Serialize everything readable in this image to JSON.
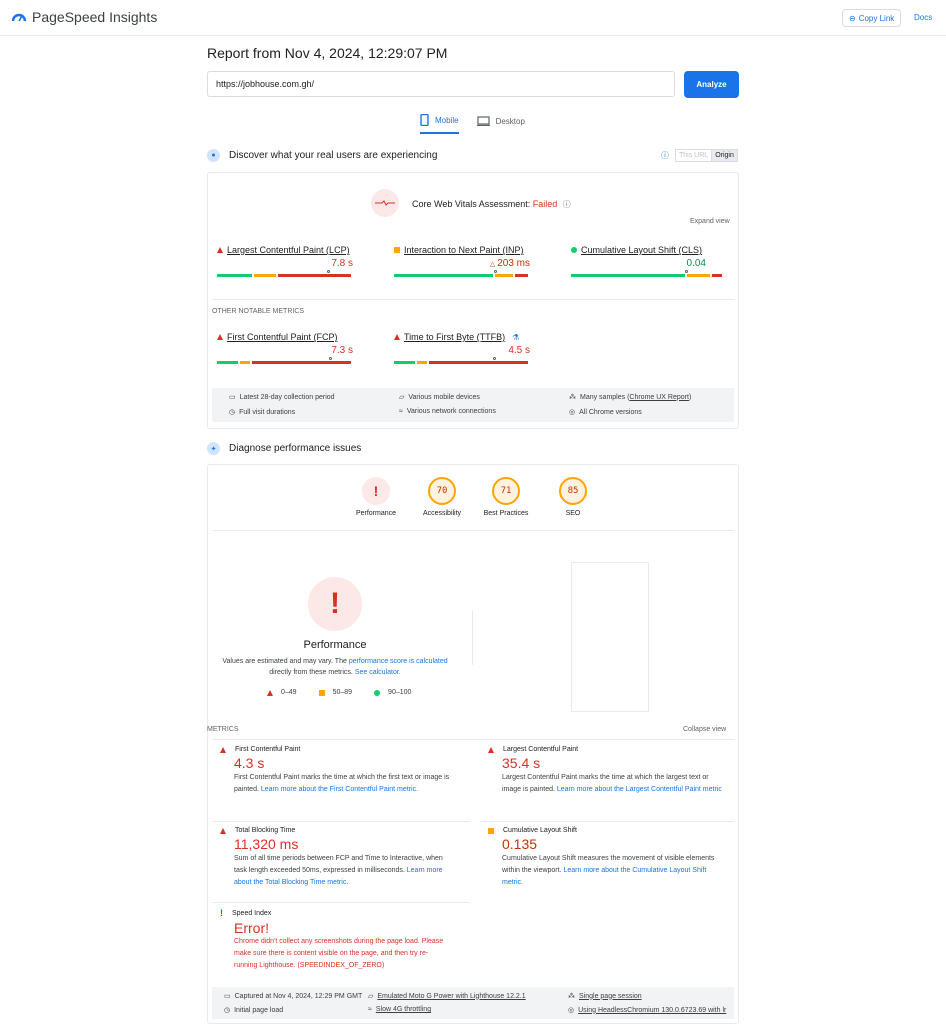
{
  "app": {
    "title": "PageSpeed Insights",
    "copy_link": "Copy Link",
    "docs": "Docs"
  },
  "report": {
    "title": "Report from Nov 4, 2024, 12:29:07 PM",
    "url": "https://jobhouse.com.gh/",
    "analyze": "Analyze",
    "tabs": [
      "Mobile",
      "Desktop"
    ]
  },
  "field": {
    "heading": "Discover what your real users are experiencing",
    "toggle": [
      "This URL",
      "Origin"
    ],
    "assessment_label": "Core Web Vitals Assessment:",
    "assessment_status": "Failed",
    "expand": "Expand view",
    "other_label": "OTHER NOTABLE METRICS",
    "metrics": [
      {
        "name": "Largest Contentful Paint (LCP)",
        "value": "7.8 s",
        "status": "fail",
        "distribution": [
          0.27,
          0.18,
          0.55
        ],
        "marker": 0.82
      },
      {
        "name": "Interaction to Next Paint (INP)",
        "value": "203 ms",
        "status": "average",
        "distribution": [
          0.74,
          0.15,
          0.11
        ],
        "marker": 0.75
      },
      {
        "name": "Cumulative Layout Shift (CLS)",
        "value": "0.04",
        "status": "pass",
        "distribution": [
          0.76,
          0.16,
          0.08
        ],
        "marker": 0.76
      },
      {
        "name": "First Contentful Paint (FCP)",
        "value": "7.3 s",
        "status": "fail",
        "distribution": [
          0.17,
          0.09,
          0.74
        ],
        "marker": 0.84
      },
      {
        "name": "Time to First Byte (TTFB)",
        "value": "4.5 s",
        "status": "fail",
        "distribution": [
          0.17,
          0.09,
          0.74
        ],
        "marker": 0.74
      }
    ],
    "info": [
      "Latest 28-day collection period",
      "Various mobile devices",
      "Many samples (",
      "Chrome UX Report",
      ")",
      "Full visit durations",
      "Various network connections",
      "All Chrome versions"
    ]
  },
  "lab": {
    "heading": "Diagnose performance issues",
    "scores": [
      {
        "label": "Performance",
        "value": "!",
        "status": "fail"
      },
      {
        "label": "Accessibility",
        "value": "70",
        "status": "average"
      },
      {
        "label": "Best Practices",
        "value": "71",
        "status": "average"
      },
      {
        "label": "SEO",
        "value": "85",
        "status": "average"
      }
    ],
    "perf_title": "Performance",
    "perf_note_1": "Values are estimated and may vary. The ",
    "perf_note_link_1": "performance score is calculated",
    "perf_note_2": " directly from these metrics. ",
    "perf_note_link_2": "See calculator.",
    "legend": [
      "0–49",
      "50–89",
      "90–100"
    ],
    "metrics_label": "METRICS",
    "collapse": "Collapse view",
    "metrics": [
      {
        "name": "First Contentful Paint",
        "value": "4.3 s",
        "desc": "First Contentful Paint marks the time at which the first text or image is painted. ",
        "link": "Learn more about the First Contentful Paint metric."
      },
      {
        "name": "Largest Contentful Paint",
        "value": "35.4 s",
        "desc": "Largest Contentful Paint marks the time at which the largest text or image is painted. ",
        "link": "Learn more about the Largest Contentful Paint metric"
      },
      {
        "name": "Total Blocking Time",
        "value": "11,320 ms",
        "desc": "Sum of all time periods between FCP and Time to Interactive, when task length exceeded 50ms, expressed in milliseconds. ",
        "link": "Learn more about the Total Blocking Time metric."
      },
      {
        "name": "Cumulative Layout Shift",
        "value": "0.135",
        "desc": "Cumulative Layout Shift measures the movement of visible elements within the viewport. ",
        "link": "Learn more about the Cumulative Layout Shift metric."
      },
      {
        "name": "Speed Index",
        "value": "Error!",
        "desc": "Chrome didn't collect any screenshots during the page load. Please make sure there is content visible on the page, and then try re-running Lighthouse. (SPEEDINDEX_OF_ZERO)",
        "link": ""
      }
    ],
    "footer": [
      "Captured at Nov 4, 2024, 12:29 PM GMT",
      "Emulated Moto G Power with Lighthouse 12.2.1",
      "Single page session",
      "Initial page load",
      "Slow 4G throttling",
      "Using HeadlessChromium 130.0.6723.69 with lr"
    ]
  },
  "colors": {
    "fail": "#d93025",
    "average": "#ffa400",
    "pass": "#0cce6b",
    "accent": "#1a73e8"
  }
}
